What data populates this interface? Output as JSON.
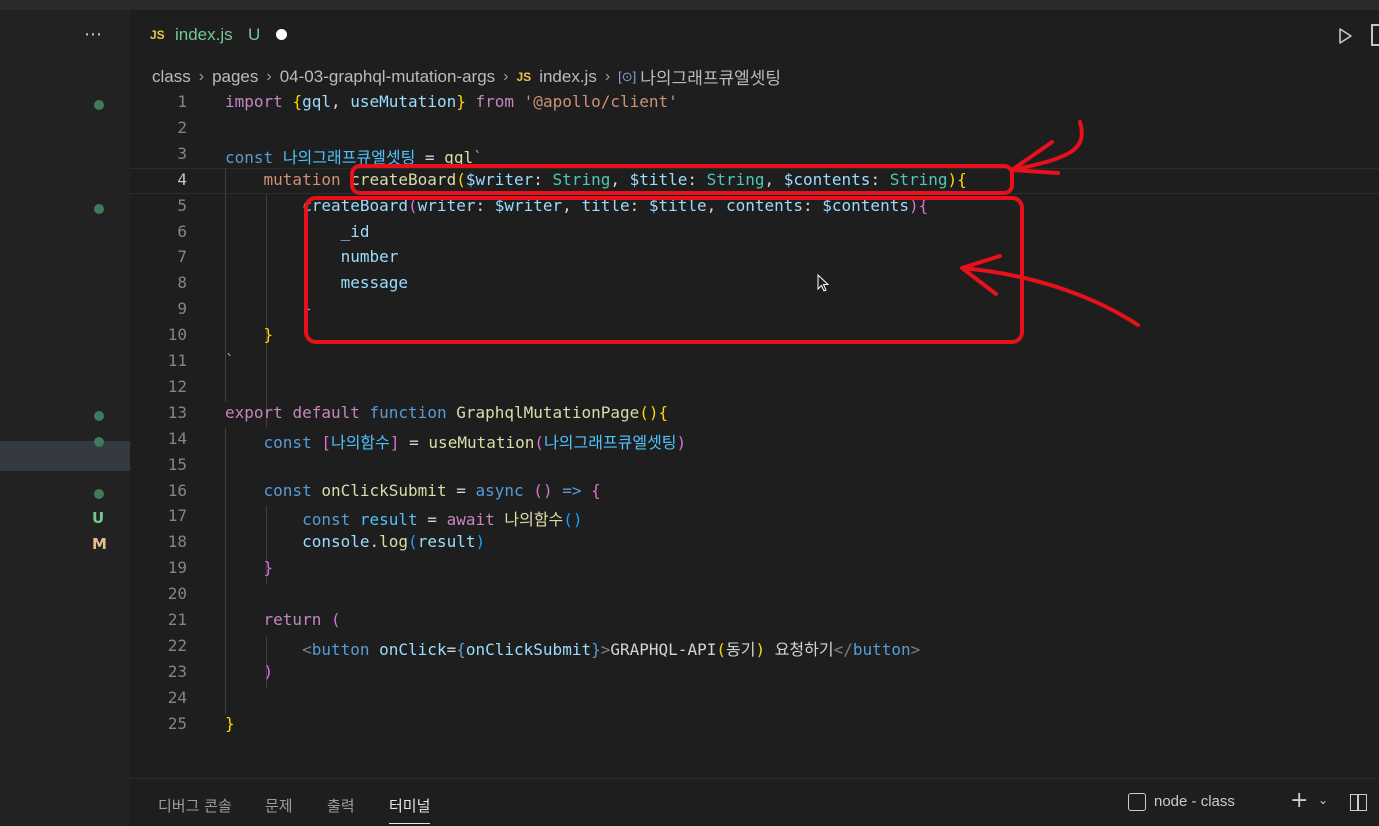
{
  "sidebar": {
    "more_label": "⋯",
    "indicators": [
      {
        "line": 1,
        "kind": "dot"
      },
      {
        "line": 5,
        "kind": "dot"
      },
      {
        "line": 13,
        "kind": "dot"
      },
      {
        "line": 14,
        "kind": "dot"
      },
      {
        "line": 16,
        "kind": "dot"
      },
      {
        "line": 17,
        "kind": "letter",
        "text": "U",
        "color": "#73c991"
      },
      {
        "line": 18,
        "kind": "letter",
        "text": "M",
        "color": "#e2c08d"
      }
    ]
  },
  "tab": {
    "icon": "JS",
    "filename": "index.js",
    "status": "U"
  },
  "breadcrumb": {
    "items": [
      "class",
      "pages",
      "04-03-graphql-mutation-args"
    ],
    "file_icon": "JS",
    "file": "index.js",
    "symbol_icon": "[⊙]",
    "symbol": "나의그래프큐엘셋팅"
  },
  "editor": {
    "active_line": 4,
    "lines": [
      {
        "n": "1",
        "tokens": [
          [
            "kw",
            "import"
          ],
          [
            "pl",
            " "
          ],
          [
            "b1",
            "{"
          ],
          [
            "vr",
            "gql"
          ],
          [
            "pl",
            ", "
          ],
          [
            "vr",
            "useMutation"
          ],
          [
            "b1",
            "}"
          ],
          [
            "pl",
            " "
          ],
          [
            "kw",
            "from"
          ],
          [
            "pl",
            " "
          ],
          [
            "str",
            "'@apollo/client'"
          ]
        ]
      },
      {
        "n": "2",
        "tokens": []
      },
      {
        "n": "3",
        "tokens": [
          [
            "st",
            "const"
          ],
          [
            "pl",
            " "
          ],
          [
            "id",
            "나의그래프큐엘셋팅"
          ],
          [
            "pl",
            " = "
          ],
          [
            "fn",
            "gql"
          ],
          [
            "str",
            "`"
          ]
        ]
      },
      {
        "n": "4",
        "tokens": [
          [
            "str",
            "    mutation "
          ],
          [
            "fn",
            "createBoard"
          ],
          [
            "b1",
            "("
          ],
          [
            "vr",
            "$writer"
          ],
          [
            "pl",
            ": "
          ],
          [
            "ty",
            "String"
          ],
          [
            "pl",
            ", "
          ],
          [
            "vr",
            "$title"
          ],
          [
            "pl",
            ": "
          ],
          [
            "ty",
            "String"
          ],
          [
            "pl",
            ", "
          ],
          [
            "vr",
            "$contents"
          ],
          [
            "pl",
            ": "
          ],
          [
            "ty",
            "String"
          ],
          [
            "b1",
            ")"
          ],
          [
            "b1",
            "{"
          ]
        ]
      },
      {
        "n": "5",
        "tokens": [
          [
            "pl",
            "        "
          ],
          [
            "vr",
            "createBoard"
          ],
          [
            "b2",
            "("
          ],
          [
            "vr",
            "writer"
          ],
          [
            "pl",
            ": "
          ],
          [
            "vr",
            "$writer"
          ],
          [
            "pl",
            ", "
          ],
          [
            "vr",
            "title"
          ],
          [
            "pl",
            ": "
          ],
          [
            "vr",
            "$title"
          ],
          [
            "pl",
            ", "
          ],
          [
            "vr",
            "contents"
          ],
          [
            "pl",
            ": "
          ],
          [
            "vr",
            "$contents"
          ],
          [
            "b2",
            ")"
          ],
          [
            "b2",
            "{"
          ]
        ]
      },
      {
        "n": "6",
        "tokens": [
          [
            "pl",
            "            "
          ],
          [
            "vr",
            "_id"
          ]
        ]
      },
      {
        "n": "7",
        "tokens": [
          [
            "pl",
            "            "
          ],
          [
            "vr",
            "number"
          ]
        ]
      },
      {
        "n": "8",
        "tokens": [
          [
            "pl",
            "            "
          ],
          [
            "vr",
            "message"
          ]
        ]
      },
      {
        "n": "9",
        "tokens": [
          [
            "pl",
            "        "
          ],
          [
            "b2",
            "}"
          ]
        ]
      },
      {
        "n": "10",
        "tokens": [
          [
            "pl",
            "    "
          ],
          [
            "b1",
            "}"
          ]
        ]
      },
      {
        "n": "11",
        "tokens": [
          [
            "str",
            "`"
          ]
        ]
      },
      {
        "n": "12",
        "tokens": []
      },
      {
        "n": "13",
        "tokens": [
          [
            "kw",
            "export"
          ],
          [
            "pl",
            " "
          ],
          [
            "kw",
            "default"
          ],
          [
            "pl",
            " "
          ],
          [
            "st",
            "function"
          ],
          [
            "pl",
            " "
          ],
          [
            "fn",
            "GraphqlMutationPage"
          ],
          [
            "b1",
            "("
          ],
          [
            "b1",
            ")"
          ],
          [
            "b1",
            "{"
          ]
        ]
      },
      {
        "n": "14",
        "tokens": [
          [
            "pl",
            "    "
          ],
          [
            "st",
            "const"
          ],
          [
            "pl",
            " "
          ],
          [
            "b2",
            "["
          ],
          [
            "id",
            "나의함수"
          ],
          [
            "b2",
            "]"
          ],
          [
            "pl",
            " = "
          ],
          [
            "fn",
            "useMutation"
          ],
          [
            "b2",
            "("
          ],
          [
            "id",
            "나의그래프큐엘셋팅"
          ],
          [
            "b2",
            ")"
          ]
        ]
      },
      {
        "n": "15",
        "tokens": []
      },
      {
        "n": "16",
        "tokens": [
          [
            "pl",
            "    "
          ],
          [
            "st",
            "const"
          ],
          [
            "pl",
            " "
          ],
          [
            "fn",
            "onClickSubmit"
          ],
          [
            "pl",
            " = "
          ],
          [
            "st",
            "async"
          ],
          [
            "pl",
            " "
          ],
          [
            "b2",
            "("
          ],
          [
            "b2",
            ")"
          ],
          [
            "pl",
            " "
          ],
          [
            "st",
            "=>"
          ],
          [
            "pl",
            " "
          ],
          [
            "b2",
            "{"
          ]
        ]
      },
      {
        "n": "17",
        "tokens": [
          [
            "pl",
            "        "
          ],
          [
            "st",
            "const"
          ],
          [
            "pl",
            " "
          ],
          [
            "id",
            "result"
          ],
          [
            "pl",
            " = "
          ],
          [
            "kw",
            "await"
          ],
          [
            "pl",
            " "
          ],
          [
            "fn",
            "나의함수"
          ],
          [
            "b3",
            "("
          ],
          [
            "b3",
            ")"
          ]
        ]
      },
      {
        "n": "18",
        "tokens": [
          [
            "pl",
            "        "
          ],
          [
            "vr",
            "console"
          ],
          [
            "pl",
            "."
          ],
          [
            "fn",
            "log"
          ],
          [
            "b3",
            "("
          ],
          [
            "vr",
            "result"
          ],
          [
            "b3",
            ")"
          ]
        ]
      },
      {
        "n": "19",
        "tokens": [
          [
            "pl",
            "    "
          ],
          [
            "b2",
            "}"
          ]
        ]
      },
      {
        "n": "20",
        "tokens": []
      },
      {
        "n": "21",
        "tokens": [
          [
            "pl",
            "    "
          ],
          [
            "kw",
            "return"
          ],
          [
            "pl",
            " "
          ],
          [
            "b2",
            "("
          ]
        ]
      },
      {
        "n": "22",
        "tokens": [
          [
            "pl",
            "        "
          ],
          [
            "tgb",
            "<"
          ],
          [
            "tg",
            "button"
          ],
          [
            "pl",
            " "
          ],
          [
            "vr",
            "onClick"
          ],
          [
            "pl",
            "="
          ],
          [
            "st",
            "{"
          ],
          [
            "vr",
            "onClickSubmit"
          ],
          [
            "st",
            "}"
          ],
          [
            "tgb",
            ">"
          ],
          [
            "pl",
            "GRAPHQL-API"
          ],
          [
            "b1",
            "("
          ],
          [
            "pl",
            "동기"
          ],
          [
            "b1",
            ")"
          ],
          [
            "pl",
            " 요청하기"
          ],
          [
            "tgb",
            "</"
          ],
          [
            "tg",
            "button"
          ],
          [
            "tgb",
            ">"
          ]
        ]
      },
      {
        "n": "23",
        "tokens": [
          [
            "pl",
            "    "
          ],
          [
            "b2",
            ")"
          ]
        ]
      },
      {
        "n": "24",
        "tokens": []
      },
      {
        "n": "25",
        "tokens": [
          [
            "b1",
            "}"
          ]
        ]
      }
    ]
  },
  "panel": {
    "tabs": [
      "디버그 콘솔",
      "문제",
      "출력",
      "터미널"
    ],
    "active_tab": "터미널",
    "terminal_label": "node - class"
  },
  "colors": {
    "annotation": "#e8101a",
    "background": "#1e1e1e",
    "untracked": "#73c991",
    "modified": "#e2c08d"
  },
  "icons": [
    "more-icon",
    "js-file-icon",
    "modified-dot-icon",
    "run-icon",
    "split-editor-icon",
    "chevron-right-icon",
    "symbol-variable-icon",
    "terminal-icon",
    "plus-icon",
    "chevron-down-icon",
    "panel-layout-icon",
    "mouse-cursor-icon"
  ]
}
